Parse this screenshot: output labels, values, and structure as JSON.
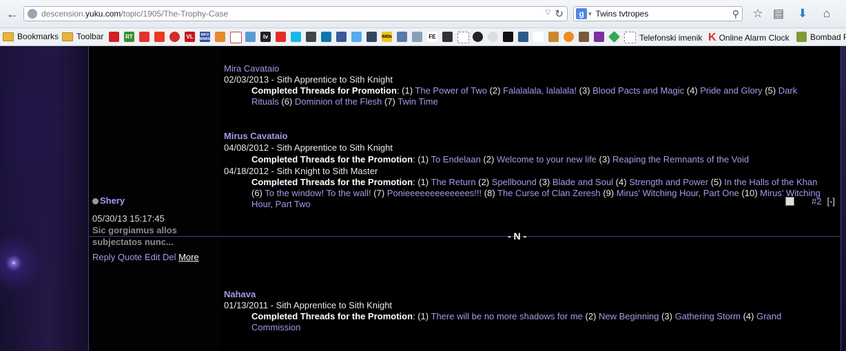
{
  "browser": {
    "url_prefix": "descension.",
    "url_host": "yuku.com",
    "url_path": "/topic/1905/The-Trophy-Case",
    "search_engine": "g",
    "search_text": "Twins tvtropes"
  },
  "bookmarks": {
    "bookmarks_label": "Bookmarks",
    "toolbar_label": "Toolbar",
    "rt": "RT",
    "vl": "VL",
    "infowars": "INFO WARS",
    "tv": "tv",
    "imdb": "IMDb",
    "fe": "FE",
    "telefonski": "Telefonski imenik",
    "alarm": "Online Alarm Clock",
    "bombad": "Bombad F"
  },
  "post1": {
    "mira": "Mira Cavataio",
    "mira_date": "02/03/2013 - Sith Apprentice to Sith Knight",
    "completed": "Completed Threads for Promotion",
    "m1": "The Power of Two",
    "m2": "Falalalala, lalalala!",
    "m3": "Blood Pacts and Magic",
    "m4": "Pride and Glory",
    "m5": "Dark Rituals",
    "m6": "Dominion of the Flesh",
    "m7": "Twin Time",
    "mirus": "Mirus Cavataio",
    "mirus_date1": "04/08/2012 - Sith Apprentice to Sith Knight",
    "completed_the": "Completed Threads for the Promotion",
    "r1": "To Endelaan",
    "r2": "Welcome to your new life",
    "r3": "Reaping the Remnants of the Void",
    "mirus_date2": "04/18/2012 - Sith Knight to Sith Master",
    "completed_the2": "Completed Threads for the  Promotion",
    "s1": "The Return",
    "s2": "Spellbound",
    "s3": "Blade and Soul",
    "s4": "Strength and Power",
    "s5": "In the Halls of the Khan",
    "s6": "To the window! To the wall!",
    "s7": "Ponieeeeeeeeeeeees!!!",
    "s8": "The Curse of Clan Zeresh",
    "s9": "Mirus' Witching Hour, Part One",
    "s10": "Mirus' Witching Hour, Part Two"
  },
  "post2": {
    "author": "Shery",
    "timestamp": "05/30/13 15:17:45",
    "sig_line1": "Sic gorgiamus allos",
    "sig_line2": "subjectatos nunc...",
    "reply": "Reply",
    "quote": "Quote",
    "edit": "Edit",
    "del": "Del",
    "more": "More",
    "number": "#2",
    "collapse": "[-]",
    "letter": "- N -",
    "nahava": "Nahava",
    "nahava_date": "01/13/2011 - Sith Apprentice to Sith Knight",
    "completed": "Completed Threads for the Promotion",
    "n1": "There will be no more shadows for me",
    "n2": "New Beginning",
    "n3": "Gathering Storm",
    "n4": "Grand Commission"
  },
  "icons": [
    "back-icon",
    "globe-icon",
    "dropdown-icon",
    "reload-icon",
    "search-icon",
    "star-icon",
    "reading-list-icon",
    "download-icon",
    "home-icon"
  ]
}
